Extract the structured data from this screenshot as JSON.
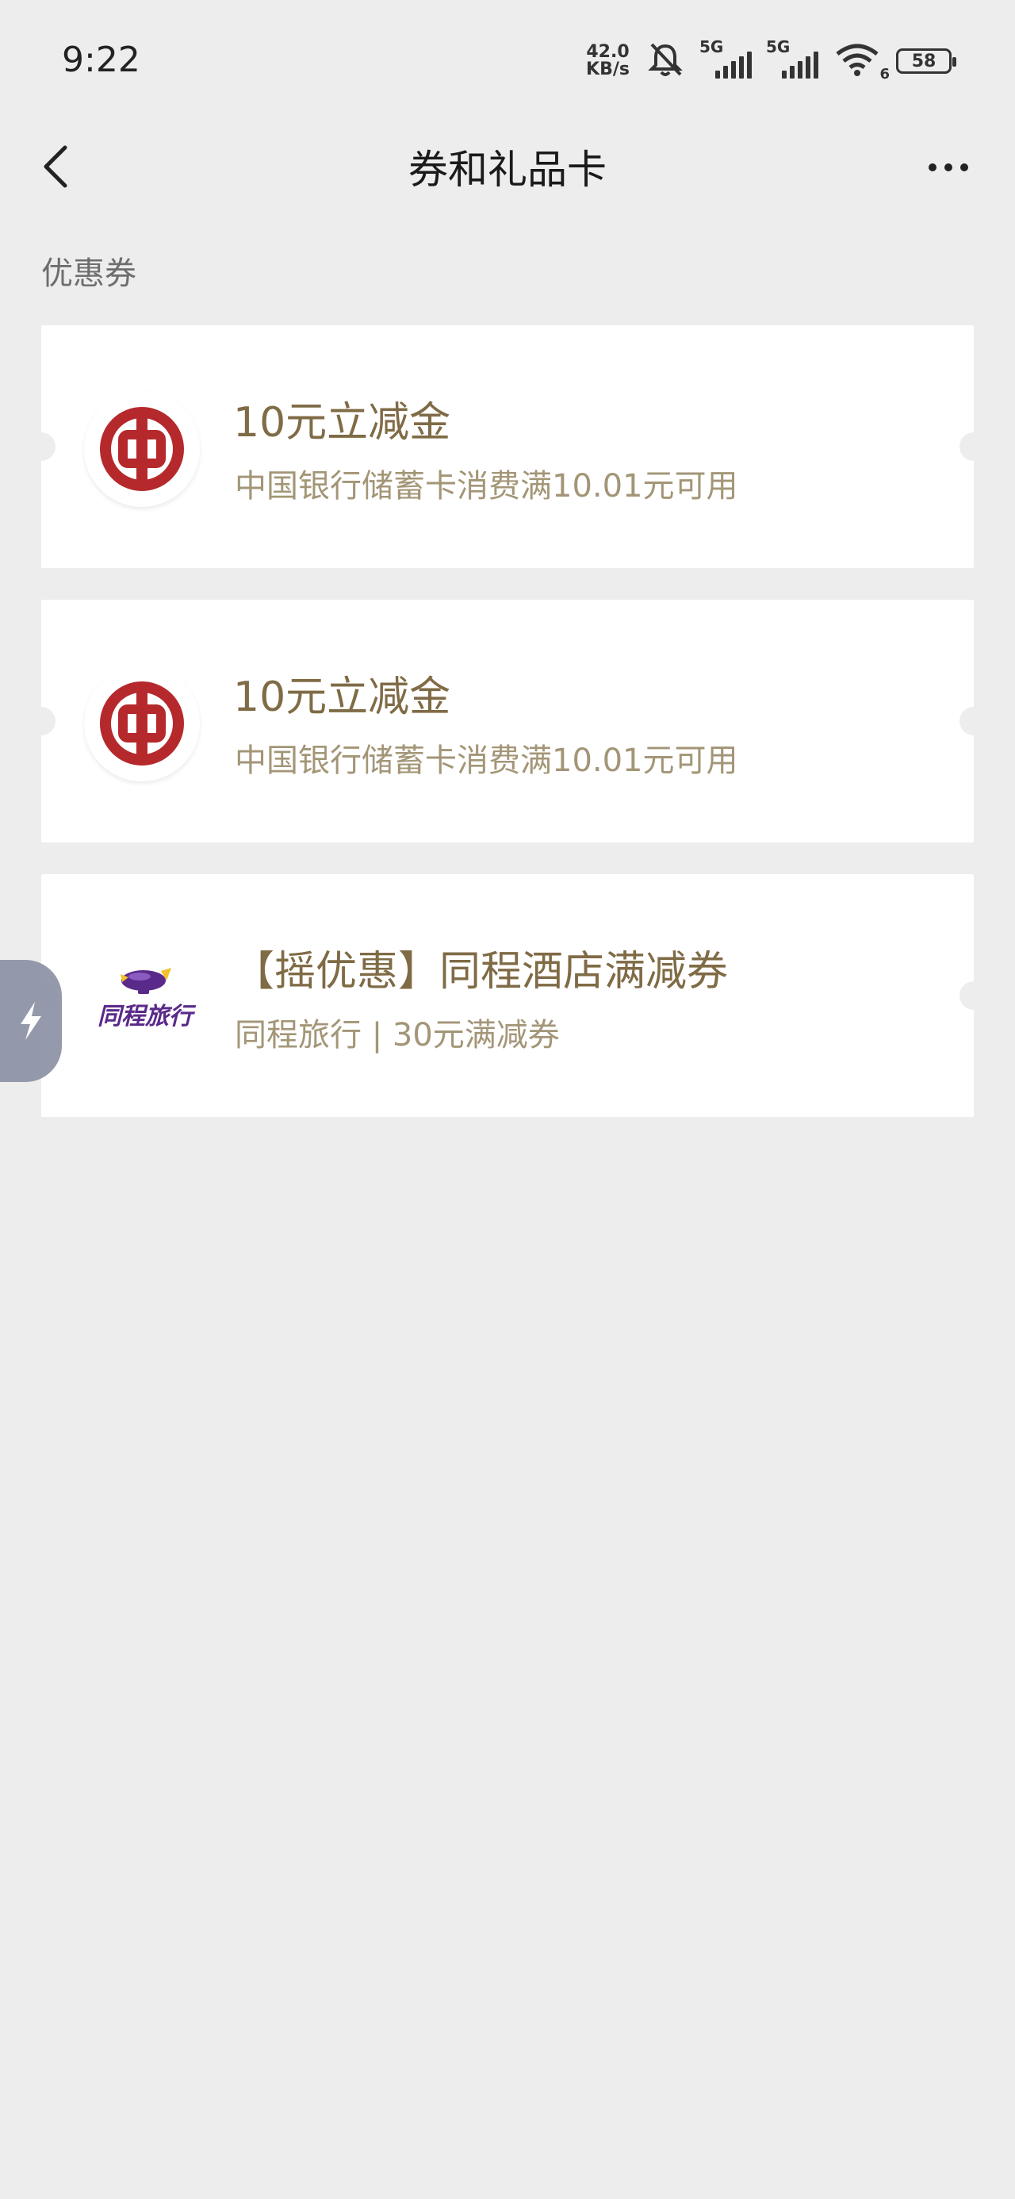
{
  "status_bar": {
    "time": "9:22",
    "net_speed_value": "42.0",
    "net_speed_unit": "KB/s",
    "signal1_tag": "5G",
    "signal2_tag": "5G",
    "wifi_tag": "6",
    "battery": "58"
  },
  "nav": {
    "title": "券和礼品卡"
  },
  "section": {
    "label": "优惠券"
  },
  "coupons": [
    {
      "title": "10元立减金",
      "subtitle": "中国银行储蓄卡消费满10.01元可用",
      "logo_icon": "bank-of-china-logo-icon"
    },
    {
      "title": "10元立减金",
      "subtitle": "中国银行储蓄卡消费满10.01元可用",
      "logo_icon": "bank-of-china-logo-icon"
    },
    {
      "title": "【摇优惠】同程酒店满减券",
      "subtitle": "同程旅行 | 30元满减券",
      "logo_icon": "tongcheng-travel-logo-icon",
      "logo_text": "同程旅行"
    }
  ],
  "colors": {
    "background": "#ededed",
    "card": "#ffffff",
    "title_gold": "#7f6b45",
    "subtitle_gold": "#a39677",
    "boc_red": "#b5292c",
    "tongcheng_purple": "#5a2a8a",
    "tongcheng_yellow": "#f3c02b"
  }
}
